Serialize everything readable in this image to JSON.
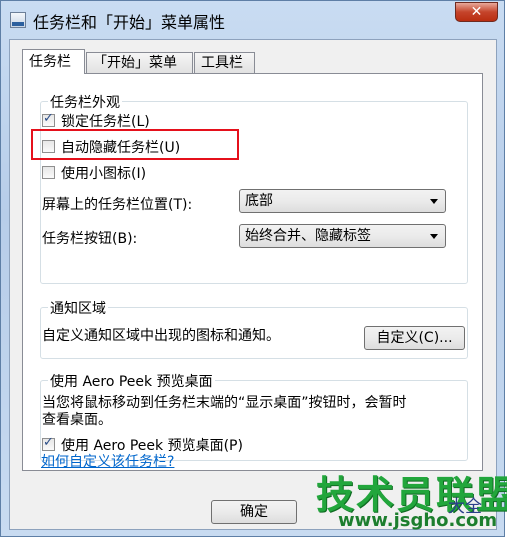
{
  "window": {
    "title": "任务栏和「开始」菜单属性",
    "close_label": "✕"
  },
  "tabs": [
    {
      "label": "任务栏",
      "active": true
    },
    {
      "label": "「开始」菜单",
      "active": false
    },
    {
      "label": "工具栏",
      "active": false
    }
  ],
  "appearance": {
    "group_label": "任务栏外观",
    "lock_taskbar": {
      "label": "锁定任务栏(L)",
      "checked": true
    },
    "auto_hide": {
      "label": "自动隐藏任务栏(U)",
      "checked": false
    },
    "small_icons": {
      "label": "使用小图标(I)",
      "checked": false
    },
    "position_label": "屏幕上的任务栏位置(T):",
    "position_value": "底部",
    "buttons_label": "任务栏按钮(B):",
    "buttons_value": "始终合并、隐藏标签"
  },
  "notification": {
    "group_label": "通知区域",
    "description": "自定义通知区域中出现的图标和通知。",
    "customize_button": "自定义(C)..."
  },
  "aero_peek": {
    "group_label": "使用 Aero Peek 预览桌面",
    "description_line1": "当您将鼠标移动到任务栏末端的“显示桌面”按钮时，会暂时",
    "description_line2": "查看桌面。",
    "checkbox": {
      "label": "使用 Aero Peek 预览桌面(P)",
      "checked": true
    }
  },
  "help_link": "如何自定义该任务栏?",
  "footer": {
    "ok_button": "确定"
  },
  "watermark": {
    "main": "技术员联盟",
    "url": "www.jsgho.com",
    "side": "大全"
  },
  "colors": {
    "highlight_border": "#e5101b",
    "link": "#0066cc"
  }
}
